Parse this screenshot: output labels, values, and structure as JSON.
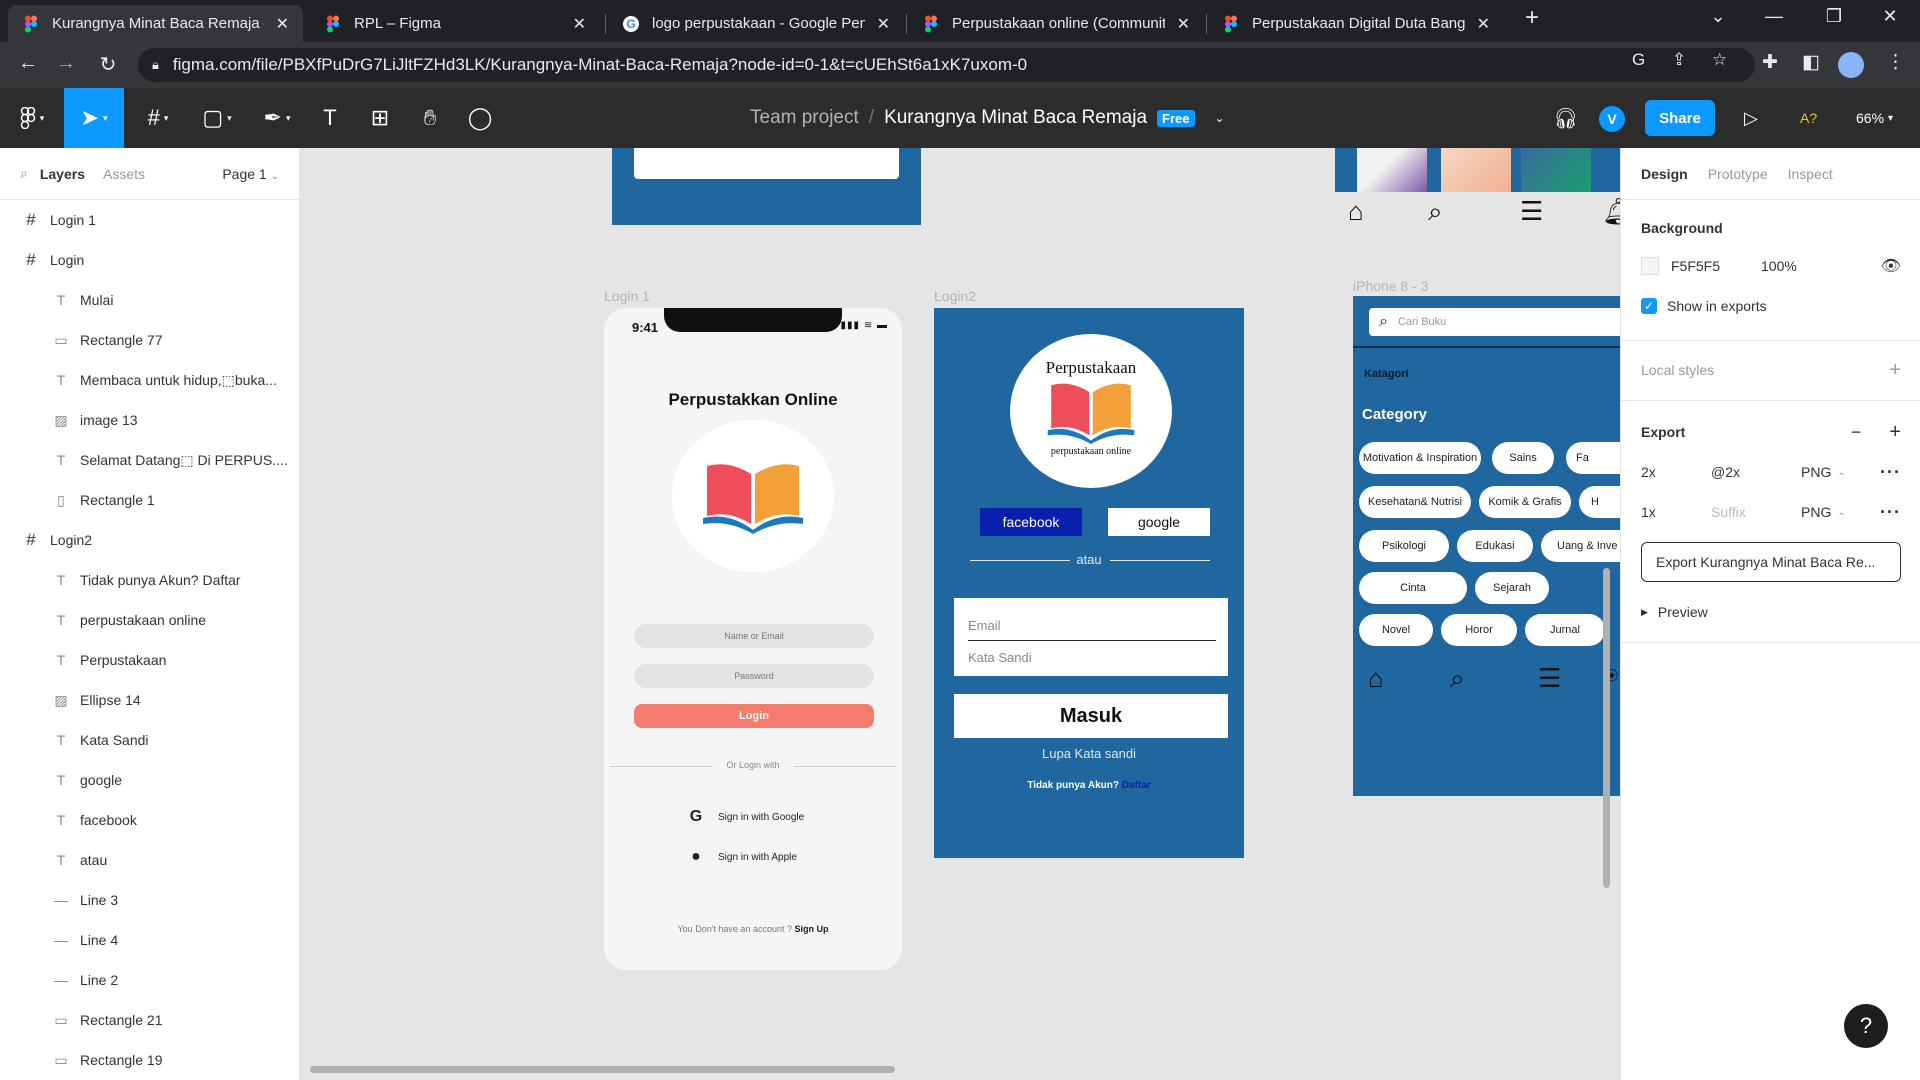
{
  "browser": {
    "tabs": [
      {
        "title": "Kurangnya Minat Baca Remaja – F",
        "active": true
      },
      {
        "title": "RPL – Figma",
        "active": false
      },
      {
        "title": "logo perpustakaan - Google Pen",
        "active": false
      },
      {
        "title": "Perpustakaan online (Community",
        "active": false
      },
      {
        "title": "Perpustakaan Digital Duta Bangs",
        "active": false
      }
    ],
    "url": "figma.com/file/PBXfPuDrG7LiJltFZHd3LK/Kurangnya-Minat-Baca-Remaja?node-id=0-1&t=cUEhSt6a1xK7uxom-0"
  },
  "toolbar": {
    "project": "Team project",
    "separator": "/",
    "file_name": "Kurangnya Minat Baca Remaja",
    "plan_badge": "Free",
    "avatar_letter": "V",
    "share_label": "Share",
    "font_warning": "A?",
    "zoom": "66%"
  },
  "left_panel": {
    "tab_layers": "Layers",
    "tab_assets": "Assets",
    "page": "Page 1",
    "layers": [
      {
        "name": "Login 1",
        "type": "frame"
      },
      {
        "name": "Login",
        "type": "frame"
      },
      {
        "name": "Mulai",
        "type": "text"
      },
      {
        "name": "Rectangle 77",
        "type": "rect-h"
      },
      {
        "name": "Membaca untuk hidup,⬚buka...",
        "type": "text"
      },
      {
        "name": "image 13",
        "type": "image"
      },
      {
        "name": "Selamat Datang⬚ Di PERPUS....",
        "type": "text"
      },
      {
        "name": "Rectangle 1",
        "type": "rect-v"
      },
      {
        "name": "Login2",
        "type": "frame"
      },
      {
        "name": "Tidak punya Akun? Daftar",
        "type": "text"
      },
      {
        "name": "perpustakaan online",
        "type": "text"
      },
      {
        "name": "Perpustakaan",
        "type": "text"
      },
      {
        "name": "Ellipse 14",
        "type": "image"
      },
      {
        "name": "Kata Sandi",
        "type": "text"
      },
      {
        "name": "google",
        "type": "text"
      },
      {
        "name": "facebook",
        "type": "text"
      },
      {
        "name": "atau",
        "type": "text"
      },
      {
        "name": "Line 3",
        "type": "line"
      },
      {
        "name": "Line 4",
        "type": "line"
      },
      {
        "name": "Line 2",
        "type": "line"
      },
      {
        "name": "Rectangle 21",
        "type": "rect-h"
      },
      {
        "name": "Rectangle 19",
        "type": "rect-h"
      }
    ]
  },
  "canvas": {
    "labels": {
      "login1": "Login 1",
      "login2": "Login2",
      "iphone": "iPhone 8 - 3"
    },
    "login1": {
      "time": "9:41",
      "title": "Perpustakkan Online",
      "email_placeholder": "Name or Email",
      "password_placeholder": "Password",
      "login_label": "Login",
      "or_text": "Or Login with",
      "google": "Sign in with Google",
      "apple": "Sign in with Apple",
      "signup_prefix": "You Don't have an account ?",
      "signup_link": "Sign Up"
    },
    "login2": {
      "title": "Perpustakaan",
      "subtitle": "perpustakaan online",
      "facebook": "facebook",
      "google": "google",
      "atau": "atau",
      "email": "Email",
      "kata_sandi": "Kata Sandi",
      "masuk": "Masuk",
      "lupa": "Lupa Kata sandi",
      "tidak": "Tidak punya Akun?",
      "daftar": "Daftar"
    },
    "iphone": {
      "search_placeholder": "Cari Buku",
      "katagori": "Katagori",
      "category": "Category",
      "chips": [
        "Motivation & Inspiration",
        "Sains",
        "Fa",
        "Kesehatan& Nutrisi",
        "Komik & Grafis",
        "H",
        "Psikologi",
        "Edukasi",
        "Uang & Inve",
        "Cinta",
        "Sejarah",
        "Novel",
        "Horor",
        "Jurnal"
      ]
    }
  },
  "right_panel": {
    "tab_design": "Design",
    "tab_prototype": "Prototype",
    "tab_inspect": "Inspect",
    "background_heading": "Background",
    "bg_color": "F5F5F5",
    "bg_opacity": "100%",
    "show_in_exports": "Show in exports",
    "local_styles": "Local styles",
    "export_heading": "Export",
    "exports": [
      {
        "scale": "2x",
        "suffix": "@2x",
        "format": "PNG"
      },
      {
        "scale": "1x",
        "suffix": "Suffix",
        "format": "PNG"
      }
    ],
    "export_button": "Export Kurangnya Minat Baca Re...",
    "preview": "Preview"
  },
  "help": "?"
}
